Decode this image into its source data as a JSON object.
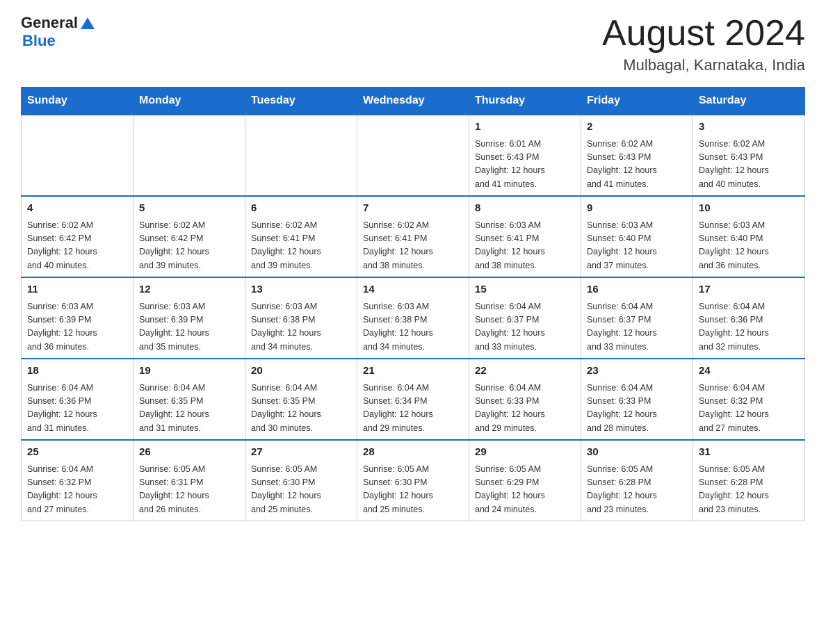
{
  "header": {
    "logo_general": "General",
    "logo_blue": "Blue",
    "title": "August 2024",
    "subtitle": "Mulbagal, Karnataka, India"
  },
  "days_of_week": [
    "Sunday",
    "Monday",
    "Tuesday",
    "Wednesday",
    "Thursday",
    "Friday",
    "Saturday"
  ],
  "weeks": [
    [
      {
        "day": "",
        "info": ""
      },
      {
        "day": "",
        "info": ""
      },
      {
        "day": "",
        "info": ""
      },
      {
        "day": "",
        "info": ""
      },
      {
        "day": "1",
        "info": "Sunrise: 6:01 AM\nSunset: 6:43 PM\nDaylight: 12 hours\nand 41 minutes."
      },
      {
        "day": "2",
        "info": "Sunrise: 6:02 AM\nSunset: 6:43 PM\nDaylight: 12 hours\nand 41 minutes."
      },
      {
        "day": "3",
        "info": "Sunrise: 6:02 AM\nSunset: 6:43 PM\nDaylight: 12 hours\nand 40 minutes."
      }
    ],
    [
      {
        "day": "4",
        "info": "Sunrise: 6:02 AM\nSunset: 6:42 PM\nDaylight: 12 hours\nand 40 minutes."
      },
      {
        "day": "5",
        "info": "Sunrise: 6:02 AM\nSunset: 6:42 PM\nDaylight: 12 hours\nand 39 minutes."
      },
      {
        "day": "6",
        "info": "Sunrise: 6:02 AM\nSunset: 6:41 PM\nDaylight: 12 hours\nand 39 minutes."
      },
      {
        "day": "7",
        "info": "Sunrise: 6:02 AM\nSunset: 6:41 PM\nDaylight: 12 hours\nand 38 minutes."
      },
      {
        "day": "8",
        "info": "Sunrise: 6:03 AM\nSunset: 6:41 PM\nDaylight: 12 hours\nand 38 minutes."
      },
      {
        "day": "9",
        "info": "Sunrise: 6:03 AM\nSunset: 6:40 PM\nDaylight: 12 hours\nand 37 minutes."
      },
      {
        "day": "10",
        "info": "Sunrise: 6:03 AM\nSunset: 6:40 PM\nDaylight: 12 hours\nand 36 minutes."
      }
    ],
    [
      {
        "day": "11",
        "info": "Sunrise: 6:03 AM\nSunset: 6:39 PM\nDaylight: 12 hours\nand 36 minutes."
      },
      {
        "day": "12",
        "info": "Sunrise: 6:03 AM\nSunset: 6:39 PM\nDaylight: 12 hours\nand 35 minutes."
      },
      {
        "day": "13",
        "info": "Sunrise: 6:03 AM\nSunset: 6:38 PM\nDaylight: 12 hours\nand 34 minutes."
      },
      {
        "day": "14",
        "info": "Sunrise: 6:03 AM\nSunset: 6:38 PM\nDaylight: 12 hours\nand 34 minutes."
      },
      {
        "day": "15",
        "info": "Sunrise: 6:04 AM\nSunset: 6:37 PM\nDaylight: 12 hours\nand 33 minutes."
      },
      {
        "day": "16",
        "info": "Sunrise: 6:04 AM\nSunset: 6:37 PM\nDaylight: 12 hours\nand 33 minutes."
      },
      {
        "day": "17",
        "info": "Sunrise: 6:04 AM\nSunset: 6:36 PM\nDaylight: 12 hours\nand 32 minutes."
      }
    ],
    [
      {
        "day": "18",
        "info": "Sunrise: 6:04 AM\nSunset: 6:36 PM\nDaylight: 12 hours\nand 31 minutes."
      },
      {
        "day": "19",
        "info": "Sunrise: 6:04 AM\nSunset: 6:35 PM\nDaylight: 12 hours\nand 31 minutes."
      },
      {
        "day": "20",
        "info": "Sunrise: 6:04 AM\nSunset: 6:35 PM\nDaylight: 12 hours\nand 30 minutes."
      },
      {
        "day": "21",
        "info": "Sunrise: 6:04 AM\nSunset: 6:34 PM\nDaylight: 12 hours\nand 29 minutes."
      },
      {
        "day": "22",
        "info": "Sunrise: 6:04 AM\nSunset: 6:33 PM\nDaylight: 12 hours\nand 29 minutes."
      },
      {
        "day": "23",
        "info": "Sunrise: 6:04 AM\nSunset: 6:33 PM\nDaylight: 12 hours\nand 28 minutes."
      },
      {
        "day": "24",
        "info": "Sunrise: 6:04 AM\nSunset: 6:32 PM\nDaylight: 12 hours\nand 27 minutes."
      }
    ],
    [
      {
        "day": "25",
        "info": "Sunrise: 6:04 AM\nSunset: 6:32 PM\nDaylight: 12 hours\nand 27 minutes."
      },
      {
        "day": "26",
        "info": "Sunrise: 6:05 AM\nSunset: 6:31 PM\nDaylight: 12 hours\nand 26 minutes."
      },
      {
        "day": "27",
        "info": "Sunrise: 6:05 AM\nSunset: 6:30 PM\nDaylight: 12 hours\nand 25 minutes."
      },
      {
        "day": "28",
        "info": "Sunrise: 6:05 AM\nSunset: 6:30 PM\nDaylight: 12 hours\nand 25 minutes."
      },
      {
        "day": "29",
        "info": "Sunrise: 6:05 AM\nSunset: 6:29 PM\nDaylight: 12 hours\nand 24 minutes."
      },
      {
        "day": "30",
        "info": "Sunrise: 6:05 AM\nSunset: 6:28 PM\nDaylight: 12 hours\nand 23 minutes."
      },
      {
        "day": "31",
        "info": "Sunrise: 6:05 AM\nSunset: 6:28 PM\nDaylight: 12 hours\nand 23 minutes."
      }
    ]
  ]
}
